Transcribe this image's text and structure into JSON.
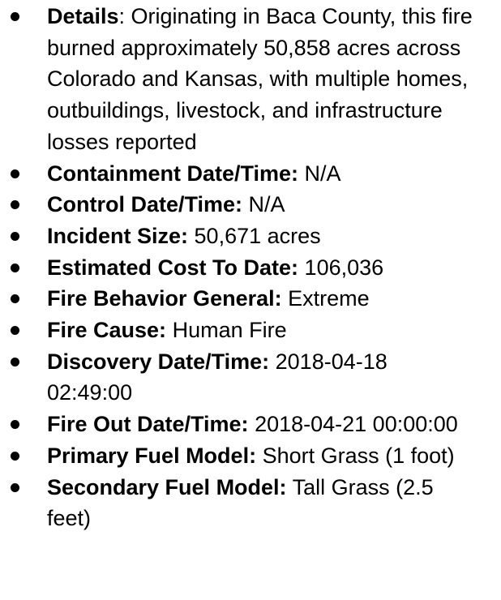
{
  "items": [
    {
      "label": "Details",
      "value": ": Originating in Baca County, this fire burned approximately 50,858 acres across Colorado and Kansas, with multiple homes, outbuildings, livestock, and infrastructure losses reported"
    },
    {
      "label": "Containment Date/Time:",
      "value": " N/A"
    },
    {
      "label": "Control Date/Time:",
      "value": " N/A"
    },
    {
      "label": "Incident Size:",
      "value": " 50,671 acres"
    },
    {
      "label": "Estimated Cost To Date:",
      "value": " 106,036"
    },
    {
      "label": "Fire Behavior General:",
      "value": " Extreme"
    },
    {
      "label": "Fire Cause:",
      "value": " Human Fire"
    },
    {
      "label": "Discovery Date/Time:",
      "value": " 2018-04-18 02:49:00"
    },
    {
      "label": "Fire Out Date/Time:",
      "value": " 2018-04-21 00:00:00"
    },
    {
      "label": "Primary Fuel Model:",
      "value": " Short Grass (1 foot)"
    },
    {
      "label": "Secondary Fuel Model:",
      "value": " Tall Grass (2.5 feet)"
    }
  ]
}
